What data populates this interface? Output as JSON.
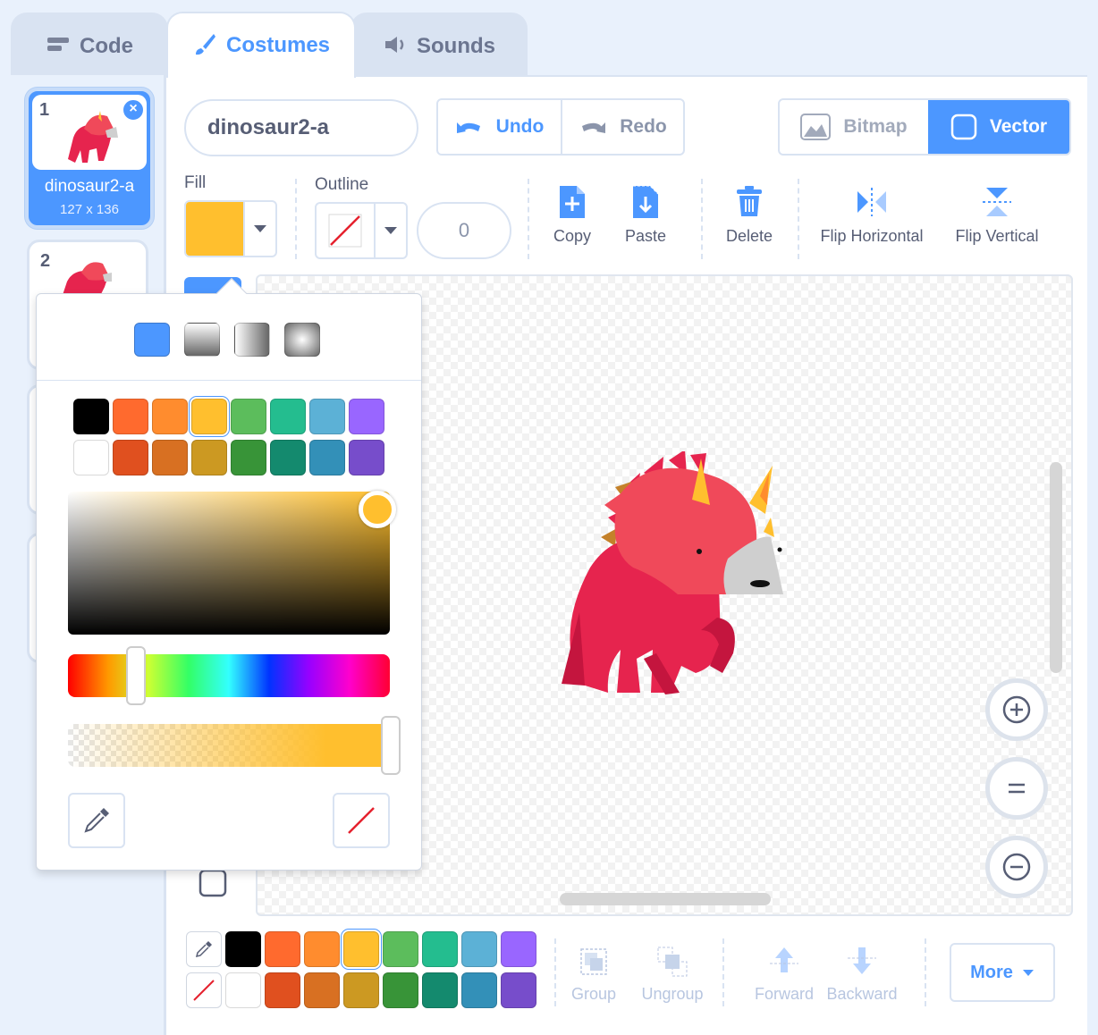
{
  "tabs": {
    "code": "Code",
    "costumes": "Costumes",
    "sounds": "Sounds"
  },
  "costumes": [
    {
      "num": "1",
      "name": "dinosaur2-a",
      "size": "127 x 136",
      "selected": true
    },
    {
      "num": "2"
    }
  ],
  "editor": {
    "costume_name": "dinosaur2-a",
    "undo": "Undo",
    "redo": "Redo",
    "bitmap": "Bitmap",
    "vector": "Vector",
    "fill_label": "Fill",
    "outline_label": "Outline",
    "outline_width": "0",
    "fill_color": "#ffbf2e",
    "tools": {
      "copy": "Copy",
      "paste": "Paste",
      "delete": "Delete",
      "flip_h": "Flip Horizontal",
      "flip_v": "Flip Vertical"
    }
  },
  "palette": {
    "row1": [
      "#000000",
      "#ff6a2e",
      "#ff8c2e",
      "#ffbf2e",
      "#5cbd5c",
      "#24bd8f",
      "#5cb1d6",
      "#9966ff"
    ],
    "row2": [
      "#ffffff",
      "#e0501f",
      "#d87022",
      "#cc9922",
      "#389438",
      "#148a6e",
      "#3390b8",
      "#774dcb"
    ],
    "selected": "#ffbf2e"
  },
  "bottom": {
    "group": "Group",
    "ungroup": "Ungroup",
    "forward": "Forward",
    "backward": "Backward",
    "more": "More"
  }
}
